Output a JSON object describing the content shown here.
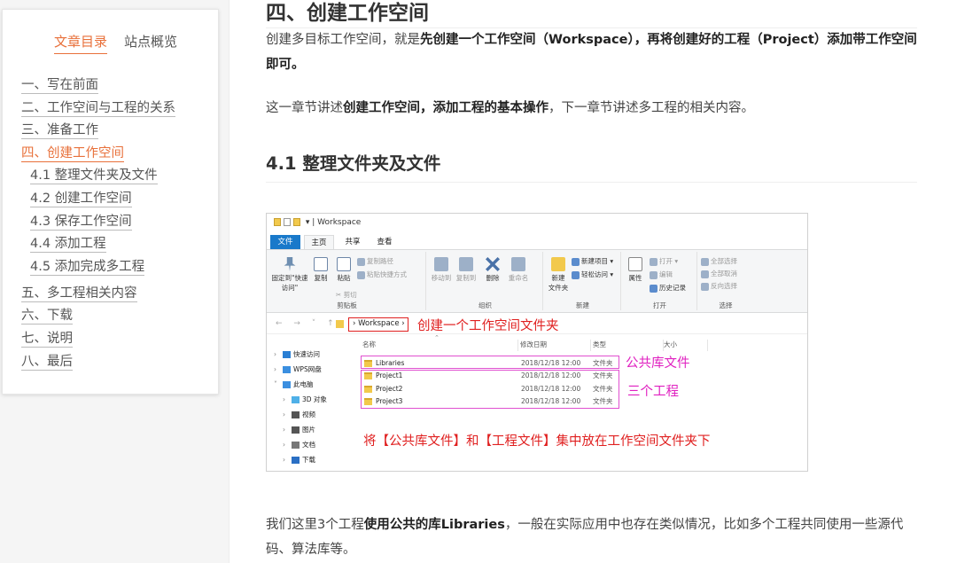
{
  "toc": {
    "tabs": [
      "文章目录",
      "站点概览"
    ],
    "items": [
      {
        "label": "一、写在前面",
        "level": 1
      },
      {
        "label": "二、工作空间与工程的关系",
        "level": 1
      },
      {
        "label": "三、准备工作",
        "level": 1
      },
      {
        "label": "四、创建工作空间",
        "level": 1,
        "active": true
      },
      {
        "label": "4.1 整理文件夹及文件",
        "level": 2
      },
      {
        "label": "4.2 创建工作空间",
        "level": 2
      },
      {
        "label": "4.3 保存工作空间",
        "level": 2
      },
      {
        "label": "4.4 添加工程",
        "level": 2
      },
      {
        "label": "4.5 添加完成多工程",
        "level": 2
      },
      {
        "label": "五、多工程相关内容",
        "level": 1
      },
      {
        "label": "六、下载",
        "level": 1
      },
      {
        "label": "七、说明",
        "level": 1
      },
      {
        "label": "八、最后",
        "level": 1
      }
    ]
  },
  "article": {
    "h2": "四、创建工作空间",
    "p1_a": "创建多目标工作空间，就是",
    "p1_b": "先创建一个工作空间（Workspace），再将创建好的工程（Project）添加带工作空间即可。",
    "p2_a": "这一章节讲述",
    "p2_b": "创建工作空间，添加工程的基本操作",
    "p2_c": "，下一章节讲述多工程的相关内容。",
    "h3": "4.1 整理文件夹及文件",
    "p3_a": "我们这里3个工程",
    "p3_b": "使用公共的库Libraries",
    "p3_c": "，一般在实际应用中也存在类似情况，比如多个工程共同使用一些源代码、算法库等。"
  },
  "explorer": {
    "title": "Workspace",
    "tabs": [
      "文件",
      "主页",
      "共享",
      "查看"
    ],
    "ribbon": {
      "clipboard": {
        "pin": "固定到\"快速访问\"",
        "copy": "复制",
        "paste": "粘贴",
        "copy_path": "复制路径",
        "paste_shortcut": "粘贴快捷方式",
        "cut": "剪切",
        "label": "剪贴板"
      },
      "organize": {
        "move": "移动到",
        "copyto": "复制到",
        "delete": "删除",
        "rename": "重命名",
        "label": "组织"
      },
      "new": {
        "newfolder": "新建\n文件夹",
        "newitem": "新建项目 ▾",
        "easy": "轻松访问 ▾",
        "label": "新建"
      },
      "open": {
        "props": "属性",
        "open": "打开 ▾",
        "edit": "编辑",
        "history": "历史记录",
        "label": "打开"
      },
      "select": {
        "all": "全部选择",
        "none": "全部取消",
        "invert": "反向选择",
        "label": "选择"
      }
    },
    "address": "Workspace",
    "nav": "←  →  ˅  ↑",
    "columns": [
      "名称",
      "修改日期",
      "类型",
      "大小"
    ],
    "rows": [
      {
        "name": "Libraries",
        "date": "2018/12/18 12:00",
        "type": "文件夹"
      },
      {
        "name": "Project1",
        "date": "2018/12/18 12:00",
        "type": "文件夹"
      },
      {
        "name": "Project2",
        "date": "2018/12/18 12:00",
        "type": "文件夹"
      },
      {
        "name": "Project3",
        "date": "2018/12/18 12:00",
        "type": "文件夹"
      }
    ],
    "tree": [
      {
        "label": "快速访问",
        "chev": "›",
        "color": "#2a7fd4"
      },
      {
        "label": "WPS网盘",
        "chev": "›",
        "color": "#3b8fe0"
      },
      {
        "label": "此电脑",
        "chev": "˅",
        "color": "#3b8fe0"
      },
      {
        "label": "3D 对象",
        "chev": "›",
        "color": "#4fb0e8",
        "indent": true
      },
      {
        "label": "视频",
        "chev": "›",
        "color": "#555",
        "indent": true
      },
      {
        "label": "图片",
        "chev": "›",
        "color": "#555",
        "indent": true
      },
      {
        "label": "文档",
        "chev": "›",
        "color": "#777",
        "indent": true
      },
      {
        "label": "下载",
        "chev": "›",
        "color": "#2a6fc4",
        "indent": true
      }
    ],
    "annotations": {
      "create_folder": "创建一个工作空间文件夹",
      "lib": "公共库文件",
      "projects": "三个工程",
      "caption": "将【公共库文件】和【工程文件】集中放在工作空间文件夹下"
    },
    "colors": {
      "file_tab": "#1979ca",
      "annot_red": "#e02020",
      "annot_magenta": "#e020c0",
      "folder": "#f2c94c"
    }
  },
  "colors": {
    "accent": "#e8703a"
  }
}
